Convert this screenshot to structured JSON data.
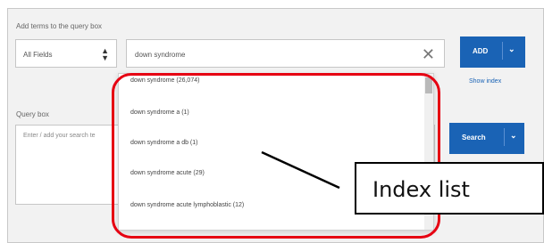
{
  "add_terms_label": "Add terms to the query box",
  "field_select": {
    "value": "All Fields"
  },
  "term_input": {
    "value": "down syndrome"
  },
  "add_button": {
    "label": "ADD"
  },
  "show_index_label": "Show index",
  "query_box": {
    "label": "Query box",
    "placeholder": "Enter / add your search te"
  },
  "search_button": {
    "label": "Search"
  },
  "index_list": {
    "items": [
      "down syndrome (26,074)",
      "down syndrome a (1)",
      "down syndrome a db (1)",
      "down syndrome acute (29)",
      "down syndrome acute lymphoblastic (12)"
    ]
  },
  "callout": {
    "label": "Index list"
  },
  "colors": {
    "accent": "#1a63b5",
    "highlight": "#e60012"
  },
  "icons": {
    "clear": "close-icon",
    "select": "up-down-arrows-icon",
    "button_menu": "chevron-down-icon"
  }
}
